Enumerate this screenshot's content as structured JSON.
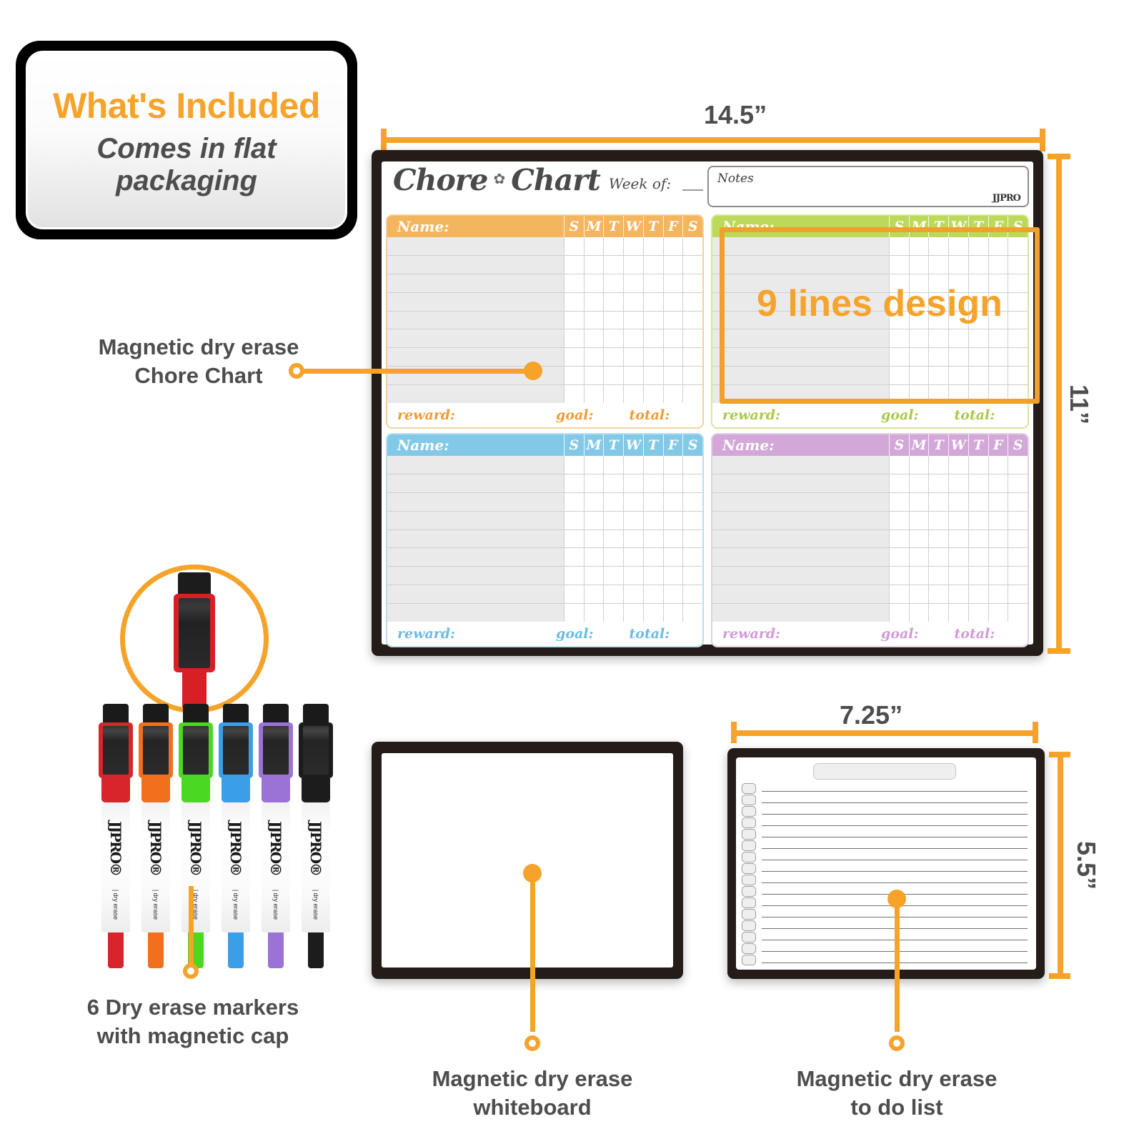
{
  "badge": {
    "title": "What's Included",
    "subtitle": "Comes in flat\npackaging"
  },
  "callouts": {
    "chore_chart": "Magnetic dry erase\nChore Chart",
    "markers": "6 Dry erase markers\nwith magnetic cap",
    "whiteboard": "Magnetic dry erase\nwhiteboard",
    "todo": "Magnetic dry erase\nto do list"
  },
  "dimensions": {
    "chore_width": "14.5”",
    "chore_height": "11”",
    "todo_width": "7.25”",
    "todo_height": "5.5”"
  },
  "chore_chart": {
    "title": "Chore",
    "title2": "Chart",
    "swirl_icon": "swirl-icon",
    "week_of_label": "Week of:",
    "notes_label": "Notes",
    "brand": "JJPRO",
    "name_label": "Name:",
    "days": [
      "S",
      "M",
      "T",
      "W",
      "T",
      "F",
      "S"
    ],
    "footer": {
      "reward": "reward:",
      "goal": "goal:",
      "total": "total:"
    },
    "row_count": 9,
    "highlight_text": "9 lines design",
    "quadrants": [
      {
        "id": "orange",
        "accent": "#f4b55f"
      },
      {
        "id": "green",
        "accent": "#bcd95a"
      },
      {
        "id": "blue",
        "accent": "#82c9e8"
      },
      {
        "id": "purple",
        "accent": "#d3a7d8"
      }
    ]
  },
  "markers": {
    "count": 6,
    "brand": "JJPRO",
    "registered": "®",
    "sub": "| dry erase",
    "colors": [
      "#d8242b",
      "#f26f1e",
      "#4bd820",
      "#3b9ee8",
      "#9b73d6",
      "#1c1c1c"
    ],
    "color_names": [
      "red",
      "orange",
      "green",
      "blue",
      "purple",
      "black"
    ]
  },
  "todo_list": {
    "row_count": 16,
    "title_field": ""
  },
  "theme": {
    "accent": "#f5a32a",
    "text": "#4d4d4d",
    "frame": "#241c18"
  }
}
